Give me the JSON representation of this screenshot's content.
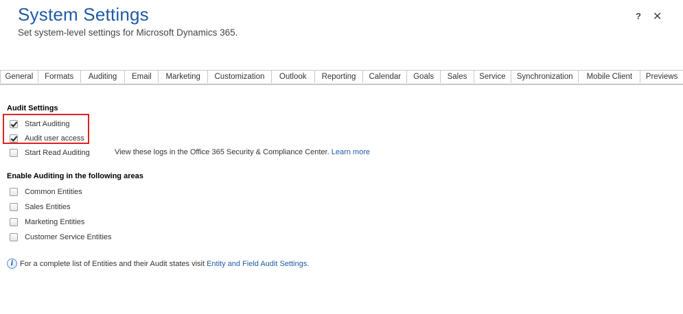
{
  "header": {
    "title": "System Settings",
    "subtitle": "Set system-level settings for Microsoft Dynamics 365.",
    "help_label": "?",
    "close_label": "✕"
  },
  "tabs": [
    {
      "label": "General"
    },
    {
      "label": "Formats"
    },
    {
      "label": "Auditing",
      "active": true
    },
    {
      "label": "Email"
    },
    {
      "label": "Marketing"
    },
    {
      "label": "Customization"
    },
    {
      "label": "Outlook"
    },
    {
      "label": "Reporting"
    },
    {
      "label": "Calendar"
    },
    {
      "label": "Goals"
    },
    {
      "label": "Sales"
    },
    {
      "label": "Service"
    },
    {
      "label": "Synchronization"
    },
    {
      "label": "Mobile Client"
    },
    {
      "label": "Previews"
    }
  ],
  "audit_settings": {
    "title": "Audit Settings",
    "items": [
      {
        "label": "Start Auditing",
        "checked": true
      },
      {
        "label": "Audit user access",
        "checked": true
      },
      {
        "label": "Start Read Auditing",
        "checked": false
      }
    ],
    "read_note": "View these logs in the Office 365 Security & Compliance Center.",
    "read_link": "Learn more"
  },
  "areas": {
    "title": "Enable Auditing in the following areas",
    "items": [
      {
        "label": "Common Entities",
        "checked": false
      },
      {
        "label": "Sales Entities",
        "checked": false
      },
      {
        "label": "Marketing Entities",
        "checked": false
      },
      {
        "label": "Customer Service Entities",
        "checked": false
      }
    ]
  },
  "info": {
    "icon": "info-icon",
    "text": "For a complete list of Entities and their Audit states visit",
    "link": "Entity and Field Audit Settings",
    "suffix": "."
  },
  "colors": {
    "title": "#1f5aa6",
    "link": "#1f5aa6",
    "highlight": "#e02020"
  }
}
